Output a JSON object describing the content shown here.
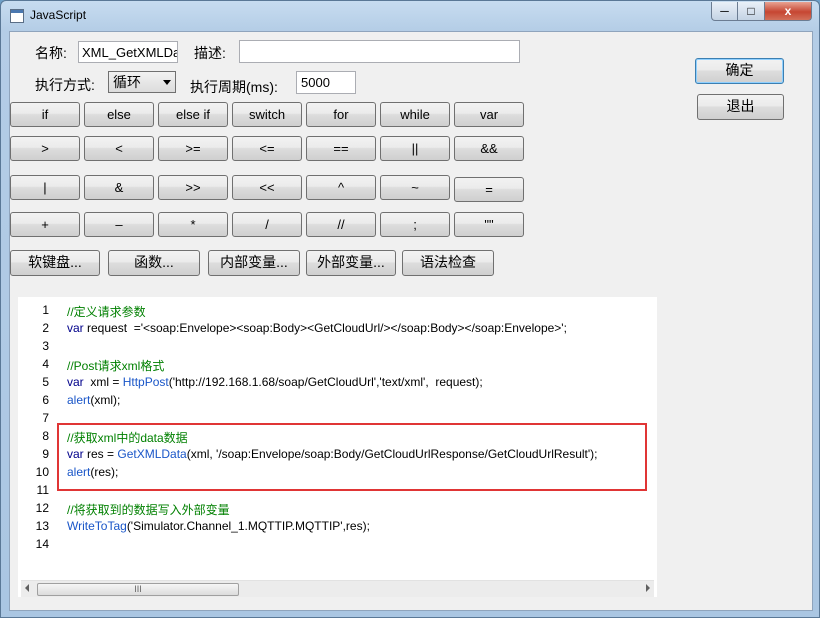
{
  "window": {
    "title": "JavaScript",
    "min_label": "─",
    "max_label": "□",
    "close_label": "x"
  },
  "form": {
    "name_label": "名称:",
    "name_value": "XML_GetXMLData",
    "desc_label": "描述:",
    "desc_value": "",
    "mode_label": "执行方式:",
    "mode_value": "循环",
    "period_label": "执行周期(ms):",
    "period_value": "5000"
  },
  "actions": {
    "ok": "确定",
    "exit": "退出"
  },
  "keypad": {
    "row1": [
      "if",
      "else",
      "else if",
      "switch",
      "for",
      "while",
      "var"
    ],
    "row2": [
      ">",
      "<",
      ">=",
      "<=",
      "==",
      "||",
      "&&"
    ],
    "row3": [
      "|",
      "&",
      ">>",
      "<<",
      "^",
      "~",
      "="
    ],
    "row4": [
      "+",
      "–",
      "*",
      "/",
      "//",
      ";",
      "\"\""
    ]
  },
  "tools": [
    "软键盘...",
    "函数...",
    "内部变量...",
    "外部变量...",
    "语法检查"
  ],
  "code": {
    "line_numbers": [
      "1",
      "2",
      "3",
      "4",
      "5",
      "6",
      "7",
      "8",
      "9",
      "10",
      "11",
      "12",
      "13",
      "14"
    ],
    "l1": "//定义请求参数",
    "l2_kw": "var",
    "l2_rest": " request  ='<soap:Envelope><soap:Body><GetCloudUrl/></soap:Body></soap:Envelope>';",
    "l4": "//Post请求xml格式",
    "l5_kw": "var",
    "l5_a": "  xml = ",
    "l5_fn": "HttpPost",
    "l5_b": "('http://192.168.1.68/soap/GetCloudUrl','text/xml',  request);",
    "l6_fn": "alert",
    "l6_b": "(xml);",
    "l8": "//获取xml中的data数据",
    "l9_kw": "var",
    "l9_a": " res = ",
    "l9_fn": "GetXMLData",
    "l9_b": "(xml, '/soap:Envelope/soap:Body/GetCloudUrlResponse/GetCloudUrlResult');",
    "l10_fn": "alert",
    "l10_b": "(res);",
    "l12": "//将获取到的数据写入外部变量",
    "l13_fn": "WriteToTag",
    "l13_b": "('Simulator.Channel_1.MQTTIP.MQTTIP',res);"
  },
  "scroll": {
    "thumb_grip": "III"
  }
}
